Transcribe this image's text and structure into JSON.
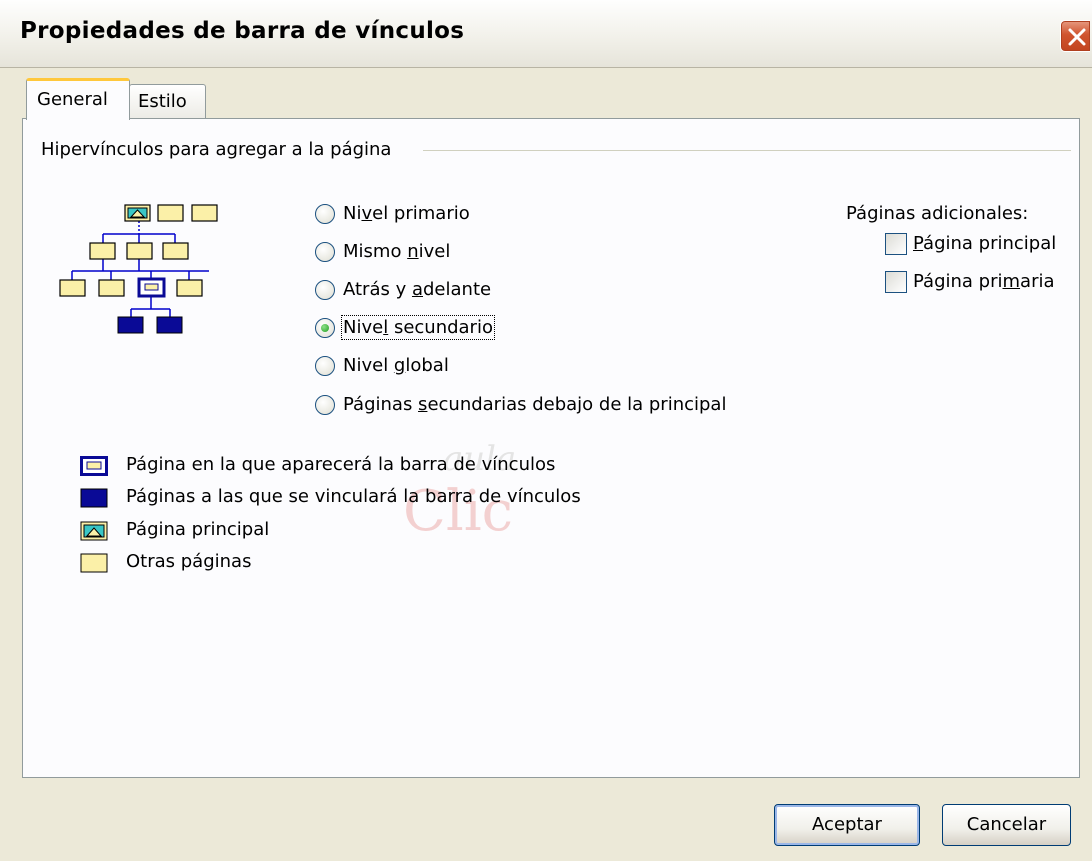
{
  "window": {
    "title": "Propiedades de barra de vínculos",
    "close_icon": "close-icon"
  },
  "tabs": [
    {
      "label": "General",
      "selected": true
    },
    {
      "label": "Estilo",
      "selected": false
    }
  ],
  "group": {
    "label": "Hipervínculos para agregar a la página"
  },
  "radios": [
    {
      "pre": "Ni",
      "accel": "v",
      "post": "el primario",
      "selected": false
    },
    {
      "pre": "Mismo ",
      "accel": "n",
      "post": "ivel",
      "selected": false
    },
    {
      "pre": "Atrás y ",
      "accel": "a",
      "post": "delante",
      "selected": false
    },
    {
      "pre": "Nive",
      "accel": "l",
      "post": " secundario",
      "selected": true
    },
    {
      "pre": "Nivel ",
      "accel": "g",
      "post": "lobal",
      "selected": false
    },
    {
      "pre": "Páginas ",
      "accel": "s",
      "post": "ecundarias debajo de la principal",
      "selected": false
    }
  ],
  "extra_pages": {
    "title": "Páginas adicionales:",
    "checkboxes": [
      {
        "pre": "",
        "accel": "P",
        "post": "ágina principal",
        "checked": false
      },
      {
        "pre": "Página pri",
        "accel": "m",
        "post": "aria",
        "checked": false
      }
    ]
  },
  "legend": [
    {
      "icon": "current-page-icon",
      "text": "Página en la que aparecerá la barra de vínculos"
    },
    {
      "icon": "linked-page-icon",
      "text": "Páginas a las que se vinculará la barra de vínculos"
    },
    {
      "icon": "home-page-icon",
      "text": "Página principal"
    },
    {
      "icon": "other-page-icon",
      "text": "Otras páginas"
    }
  ],
  "watermark": {
    "top": "aula",
    "main": "Clic"
  },
  "buttons": {
    "ok": "Aceptar",
    "cancel": "Cancelar"
  },
  "colors": {
    "other_page": "#fbf0a8",
    "linked_page": "#0a0a96",
    "connector": "#0000cc",
    "home_page": "#39c6c6"
  }
}
